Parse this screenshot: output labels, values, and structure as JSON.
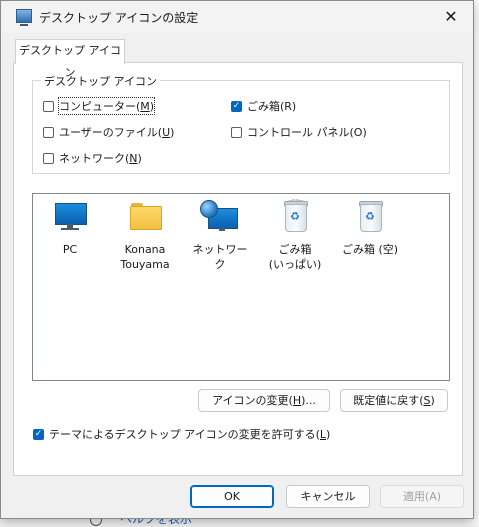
{
  "window": {
    "title": "デスクトップ アイコンの設定",
    "close_glyph": "✕"
  },
  "tab": {
    "label": "デスクトップ アイコン"
  },
  "group": {
    "legend": "デスクトップ アイコン",
    "checkboxes": [
      {
        "text": "コンピューター(",
        "key": "M",
        "tail": ")",
        "checked": false
      },
      {
        "text": "ごみ箱(R)",
        "key": "",
        "tail": "",
        "checked": true
      },
      {
        "text": "ユーザーのファイル(",
        "key": "U",
        "tail": ")",
        "checked": false
      },
      {
        "text": "コントロール パネル(O)",
        "key": "",
        "tail": "",
        "checked": false
      },
      {
        "text": "ネットワーク(",
        "key": "N",
        "tail": ")",
        "checked": false
      }
    ]
  },
  "icons": [
    {
      "label": "PC",
      "icon": "monitor-icon"
    },
    {
      "label": "Konana\nTouyama",
      "icon": "folder-icon"
    },
    {
      "label": "ネットワーク",
      "icon": "network-icon"
    },
    {
      "label": "ごみ箱\n(いっぱい)",
      "icon": "recycle-bin-full-icon"
    },
    {
      "label": "ごみ箱 (空)",
      "icon": "recycle-bin-empty-icon"
    }
  ],
  "buttons": {
    "change_icon": {
      "text": "アイコンの変更(",
      "key": "H",
      "tail": ")..."
    },
    "restore_default": {
      "text": "既定値に戻す(",
      "key": "S",
      "tail": ")"
    }
  },
  "theme_checkbox": {
    "text": "テーマによるデスクトップ アイコンの変更を許可する(",
    "key": "L",
    "tail": ")",
    "checked": true
  },
  "footer": {
    "ok": "OK",
    "cancel": "キャンセル",
    "apply": "適用(A)"
  },
  "background": {
    "link_text": "ヘルプを表示"
  },
  "colors": {
    "accent": "#0067c0"
  }
}
